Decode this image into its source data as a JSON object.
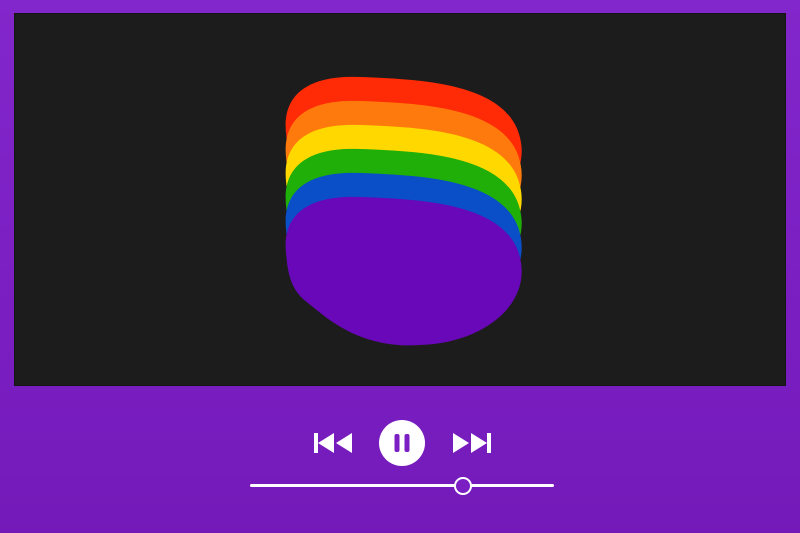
{
  "player": {
    "artwork": {
      "description_icon": "rainbow-blob-art",
      "colors": [
        "#ff2a06",
        "#ff7a0c",
        "#ffd800",
        "#1faf08",
        "#0a4fc8",
        "#6808b8"
      ]
    },
    "controls": {
      "previous_icon": "skip-previous-icon",
      "pause_icon": "pause-icon",
      "next_icon": "skip-next-icon",
      "playing": true
    },
    "progress": {
      "fraction": 0.7
    }
  },
  "theme": {
    "background": "#7b1fc4",
    "artwork_background": "#1c1c1c",
    "control_color": "#ffffff"
  }
}
